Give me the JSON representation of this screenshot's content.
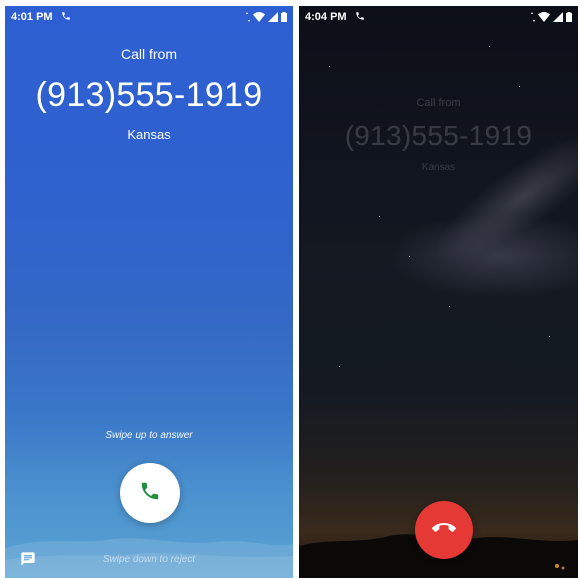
{
  "left_screen": {
    "status": {
      "time": "4:01 PM"
    },
    "call": {
      "label": "Call from",
      "number": "(913)555-1919",
      "location": "Kansas"
    },
    "hint_top": "Swipe up to answer",
    "hint_bottom": "Swipe down to reject",
    "icons": {
      "status_call": "phone-icon",
      "answer": "phone-icon",
      "message": "message-icon"
    },
    "colors": {
      "answer_icon": "#1e8e3e",
      "background_top": "#2d5fd2",
      "background_bottom": "#5aa2d2"
    }
  },
  "right_screen": {
    "status": {
      "time": "4:04 PM"
    },
    "call": {
      "label": "Call from",
      "number": "(913)555-1919",
      "location": "Kansas"
    },
    "icons": {
      "status_call": "phone-icon",
      "reject": "end-call-icon"
    },
    "colors": {
      "reject_button": "#e53935",
      "background": "#11151f"
    }
  }
}
